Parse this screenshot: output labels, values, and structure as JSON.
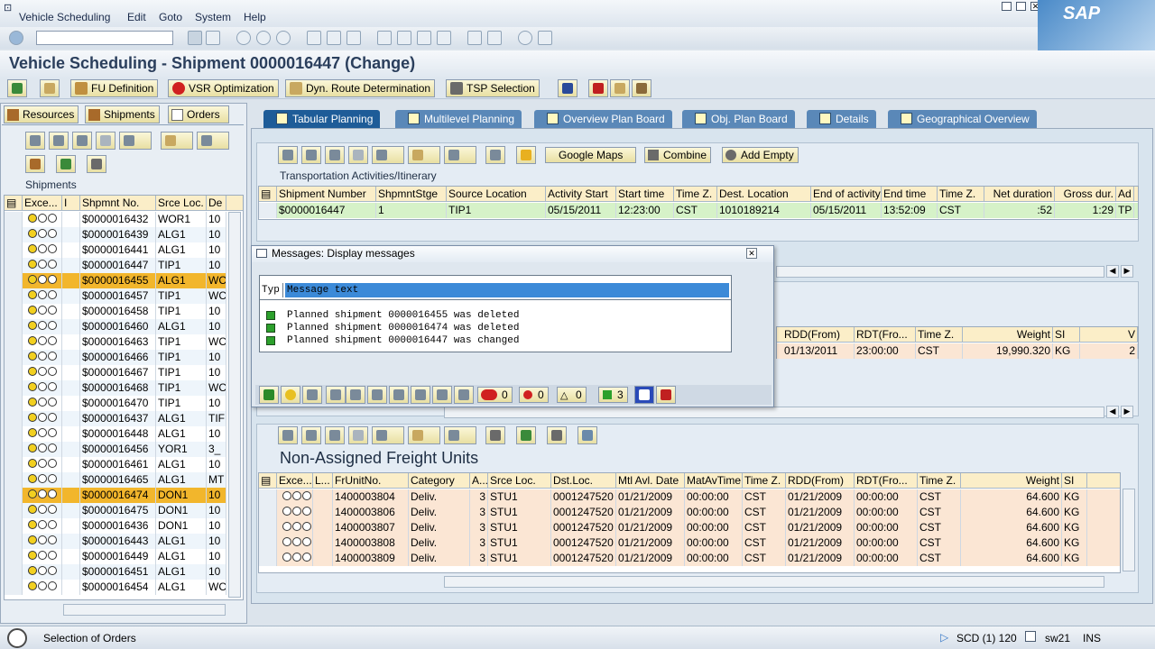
{
  "menu": [
    "Vehicle Scheduling",
    "Edit",
    "Goto",
    "System",
    "Help"
  ],
  "brand": "SAP",
  "title": "Vehicle Scheduling - Shipment 0000016447 (Change)",
  "app_toolbar": {
    "fu_definition": "FU Definition",
    "vsr_optimization": "VSR Optimization",
    "dyn_route": "Dyn. Route Determination",
    "tsp_selection": "TSP Selection"
  },
  "left": {
    "tabs": [
      "Resources",
      "Shipments",
      "Orders"
    ],
    "section_title": "Shipments",
    "headers": [
      "Exce...",
      "I",
      "Shpmnt No.",
      "Srce Loc.",
      "De"
    ],
    "rows": [
      {
        "no": "$0000016432",
        "loc": "WOR1",
        "de": "10",
        "hl": false
      },
      {
        "no": "$0000016439",
        "loc": "ALG1",
        "de": "10",
        "hl": false
      },
      {
        "no": "$0000016441",
        "loc": "ALG1",
        "de": "10",
        "hl": false
      },
      {
        "no": "$0000016447",
        "loc": "TIP1",
        "de": "10",
        "hl": false
      },
      {
        "no": "$0000016455",
        "loc": "ALG1",
        "de": "WC",
        "hl": true
      },
      {
        "no": "$0000016457",
        "loc": "TIP1",
        "de": "WC",
        "hl": false
      },
      {
        "no": "$0000016458",
        "loc": "TIP1",
        "de": "10",
        "hl": false
      },
      {
        "no": "$0000016460",
        "loc": "ALG1",
        "de": "10",
        "hl": false
      },
      {
        "no": "$0000016463",
        "loc": "TIP1",
        "de": "WC",
        "hl": false
      },
      {
        "no": "$0000016466",
        "loc": "TIP1",
        "de": "10",
        "hl": false
      },
      {
        "no": "$0000016467",
        "loc": "TIP1",
        "de": "10",
        "hl": false
      },
      {
        "no": "$0000016468",
        "loc": "TIP1",
        "de": "WC",
        "hl": false
      },
      {
        "no": "$0000016470",
        "loc": "TIP1",
        "de": "10",
        "hl": false
      },
      {
        "no": "$0000016437",
        "loc": "ALG1",
        "de": "TIF",
        "hl": false
      },
      {
        "no": "$0000016448",
        "loc": "ALG1",
        "de": "10",
        "hl": false
      },
      {
        "no": "$0000016456",
        "loc": "YOR1",
        "de": "3_",
        "hl": false
      },
      {
        "no": "$0000016461",
        "loc": "ALG1",
        "de": "10",
        "hl": false
      },
      {
        "no": "$0000016465",
        "loc": "ALG1",
        "de": "MT",
        "hl": false
      },
      {
        "no": "$0000016474",
        "loc": "DON1",
        "de": "10",
        "hl": true
      },
      {
        "no": "$0000016475",
        "loc": "DON1",
        "de": "10",
        "hl": false
      },
      {
        "no": "$0000016436",
        "loc": "DON1",
        "de": "10",
        "hl": false
      },
      {
        "no": "$0000016443",
        "loc": "ALG1",
        "de": "10",
        "hl": false
      },
      {
        "no": "$0000016449",
        "loc": "ALG1",
        "de": "10",
        "hl": false
      },
      {
        "no": "$0000016451",
        "loc": "ALG1",
        "de": "10",
        "hl": false
      },
      {
        "no": "$0000016454",
        "loc": "ALG1",
        "de": "WC",
        "hl": false
      }
    ]
  },
  "tabs": [
    "Tabular Planning",
    "Multilevel Planning",
    "Overview Plan Board",
    "Obj. Plan Board",
    "Details",
    "Geographical Overview"
  ],
  "top_section": {
    "buttons": {
      "google_maps": "Google Maps",
      "combine": "Combine",
      "add_empty": "Add Empty"
    },
    "label": "Transportation Activities/Itinerary",
    "headers": [
      "Shipment Number",
      "ShpmntStge",
      "Source Location",
      "Activity Start",
      "Start time",
      "Time Z.",
      "Dest. Location",
      "End of activity",
      "End time",
      "Time Z.",
      "Net duration",
      "Gross dur.",
      "Ad"
    ],
    "row": [
      "$0000016447",
      "1",
      "TIP1",
      "05/15/2011",
      "12:23:00",
      "CST",
      "1010189214",
      "05/15/2011",
      "13:52:09",
      "CST",
      ":52",
      "1:29",
      "TP"
    ]
  },
  "middle_section": {
    "headers": [
      "RDD(From)",
      "RDT(Fro...",
      "Time Z.",
      "Weight",
      "SI",
      "V"
    ],
    "row": [
      "01/13/2011",
      "23:00:00",
      "CST",
      "19,990.320",
      "KG",
      "2"
    ]
  },
  "dialog": {
    "title": "Messages: Display messages",
    "col_type": "Typ",
    "col_text": "Message text",
    "messages": [
      "Planned shipment 0000016455 was deleted",
      "Planned shipment 0000016474 was deleted",
      "Planned shipment 0000016447 was changed"
    ],
    "counts": {
      "stop": "0",
      "error": "0",
      "warning": "0",
      "success": "3"
    }
  },
  "bottom_section": {
    "title": "Non-Assigned Freight Units",
    "headers": [
      "Exce...",
      "L...",
      "FrUnitNo.",
      "Category",
      "A...",
      "Srce Loc.",
      "Dst.Loc.",
      "Mtl Avl. Date",
      "MatAvTime",
      "Time Z.",
      "RDD(From)",
      "RDT(Fro...",
      "Time Z.",
      "Weight",
      "SI"
    ],
    "rows": [
      [
        "1400003804",
        "Deliv.",
        "3",
        "STU1",
        "0001247520",
        "01/21/2009",
        "00:00:00",
        "CST",
        "01/21/2009",
        "00:00:00",
        "CST",
        "64.600",
        "KG"
      ],
      [
        "1400003806",
        "Deliv.",
        "3",
        "STU1",
        "0001247520",
        "01/21/2009",
        "00:00:00",
        "CST",
        "01/21/2009",
        "00:00:00",
        "CST",
        "64.600",
        "KG"
      ],
      [
        "1400003807",
        "Deliv.",
        "3",
        "STU1",
        "0001247520",
        "01/21/2009",
        "00:00:00",
        "CST",
        "01/21/2009",
        "00:00:00",
        "CST",
        "64.600",
        "KG"
      ],
      [
        "1400003808",
        "Deliv.",
        "3",
        "STU1",
        "0001247520",
        "01/21/2009",
        "00:00:00",
        "CST",
        "01/21/2009",
        "00:00:00",
        "CST",
        "64.600",
        "KG"
      ],
      [
        "1400003809",
        "Deliv.",
        "3",
        "STU1",
        "0001247520",
        "01/21/2009",
        "00:00:00",
        "CST",
        "01/21/2009",
        "00:00:00",
        "CST",
        "64.600",
        "KG"
      ]
    ]
  },
  "status": {
    "message": "Selection of Orders",
    "system": "SCD (1) 120",
    "server": "sw21",
    "mode": "INS"
  }
}
